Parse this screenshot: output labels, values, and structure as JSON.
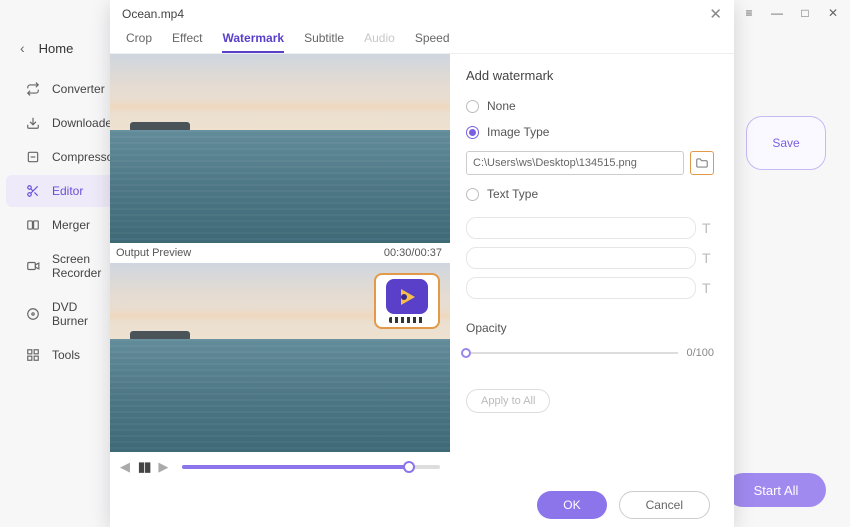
{
  "titlebar": {
    "hamburger": "≡",
    "minimize": "—",
    "maximize": "□",
    "close": "✕"
  },
  "sidebar": {
    "back_label": "Home",
    "items": [
      {
        "label": "Converter"
      },
      {
        "label": "Downloader"
      },
      {
        "label": "Compressor"
      },
      {
        "label": "Editor"
      },
      {
        "label": "Merger"
      },
      {
        "label": "Screen Recorder"
      },
      {
        "label": "DVD Burner"
      },
      {
        "label": "Tools"
      }
    ]
  },
  "bg_actions": {
    "save_label": "Save",
    "start_all_label": "Start All"
  },
  "modal": {
    "title": "Ocean.mp4",
    "tabs": [
      {
        "label": "Crop"
      },
      {
        "label": "Effect"
      },
      {
        "label": "Watermark"
      },
      {
        "label": "Subtitle"
      },
      {
        "label": "Audio"
      },
      {
        "label": "Speed"
      }
    ],
    "output_preview_label": "Output Preview",
    "time_display": "00:30/00:37",
    "footer": {
      "ok": "OK",
      "cancel": "Cancel"
    }
  },
  "watermark": {
    "section_title": "Add watermark",
    "none_label": "None",
    "image_label": "Image Type",
    "path_value": "C:\\Users\\ws\\Desktop\\134515.png",
    "text_label": "Text Type",
    "opacity_label": "Opacity",
    "opacity_value": "0/100",
    "apply_all_label": "Apply to All"
  }
}
